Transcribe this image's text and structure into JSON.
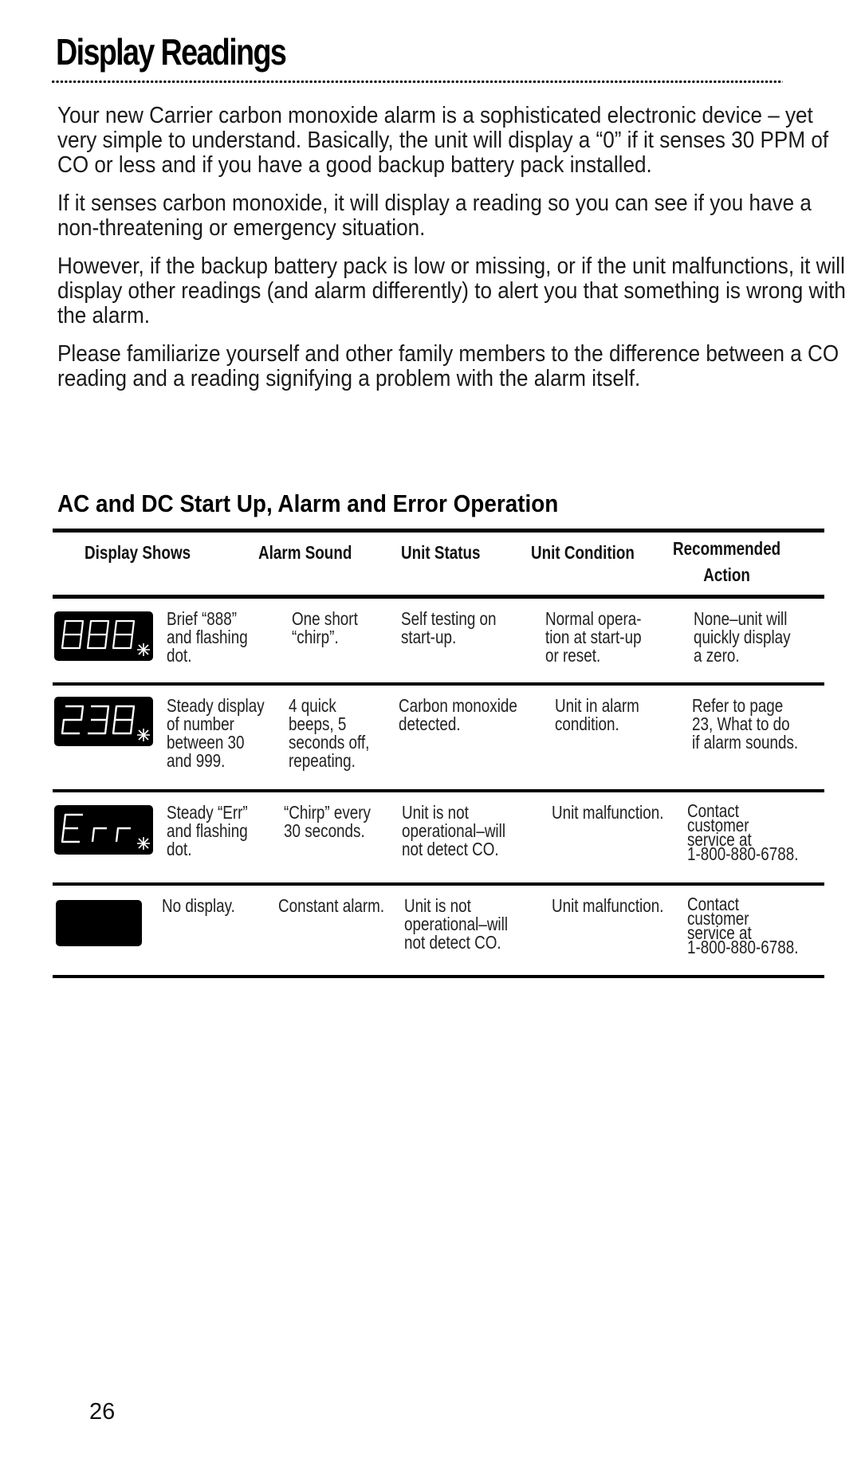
{
  "page": {
    "title": "Display Readings",
    "intro_paragraphs": [
      "Your new Carrier carbon monoxide alarm is a sophisticated electronic device – yet very simple to understand. Basically, the unit will display a “0” if it senses 30 PPM of CO or less and if you have a good backup battery pack installed.",
      "If it senses carbon monoxide, it will display a reading so you can see if you have a non-threatening or emergency situation.",
      "However, if the backup battery pack is low or missing, or if the unit malfunctions, it will display other readings (and alarm differently) to alert you that something is wrong with the alarm.",
      "Please familiarize yourself and other family members to the difference between a CO reading and a reading signifying a problem with the alarm itself."
    ],
    "page_number": "26"
  },
  "table": {
    "title": "AC and DC Start Up, Alarm and Error Operation",
    "headers": {
      "display_shows": "Display Shows",
      "alarm_sound": "Alarm Sound",
      "unit_status": "Unit Status",
      "unit_condition": "Unit Condition",
      "recommended_action": "Recommended\nAction"
    },
    "rows": [
      {
        "display_icon": "lcd-888-flashing-dot",
        "display_readout": "888",
        "display_shows": "Brief “888”\nand flashing\ndot.",
        "alarm_sound": "One short\n“chirp”.",
        "unit_status": "Self testing on\nstart-up.",
        "unit_condition": "Normal opera-\ntion at start-up\nor reset.",
        "recommended_action": "None–unit will\nquickly display\na zero."
      },
      {
        "display_icon": "lcd-238-flashing-dot",
        "display_readout": "238",
        "display_shows": "Steady display\nof number\nbetween 30\nand 999.",
        "alarm_sound": "4 quick\nbeeps, 5\nseconds off,\nrepeating.",
        "unit_status": "Carbon monoxide\ndetected.",
        "unit_condition": "Unit in alarm\ncondition.",
        "recommended_action": "Refer to page\n23, What to do\nif alarm sounds."
      },
      {
        "display_icon": "lcd-err-flashing-dot",
        "display_readout": "Err",
        "display_shows": "Steady “Err”\nand flashing\ndot.",
        "alarm_sound": "“Chirp” every\n30 seconds.",
        "unit_status": "Unit is not\noperational–will\nnot detect CO.",
        "unit_condition": "Unit malfunction.",
        "recommended_action": "Contact customer\nservice at\n1-800-880-6788."
      },
      {
        "display_icon": "lcd-blank",
        "display_readout": "",
        "display_shows": "No display.",
        "alarm_sound": "Constant alarm.",
        "unit_status": "Unit is not\noperational–will\nnot detect CO.",
        "unit_condition": "Unit malfunction.",
        "recommended_action": "Contact customer\nservice at\n1-800-880-6788."
      }
    ]
  },
  "colors": {
    "text": "#1a1a1a",
    "rule": "#000000",
    "lcd_background": "#000000",
    "lcd_segment": "#ffffff"
  }
}
